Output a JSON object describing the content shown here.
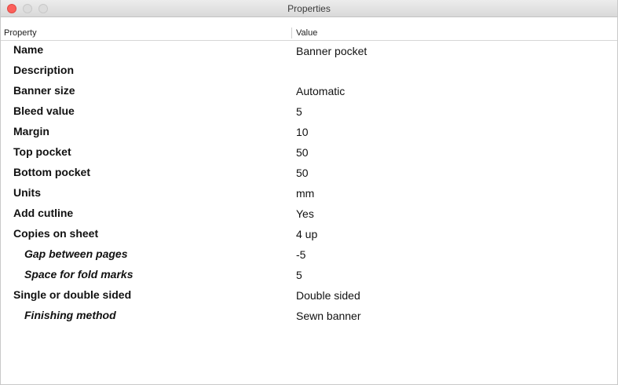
{
  "window": {
    "title": "Properties"
  },
  "table": {
    "headers": {
      "property": "Property",
      "value": "Value"
    },
    "rows": [
      {
        "name": "Name",
        "value": "Banner pocket"
      },
      {
        "name": "Description",
        "value": ""
      },
      {
        "name": "Banner size",
        "value": "Automatic"
      },
      {
        "name": "Bleed value",
        "value": "5"
      },
      {
        "name": "Margin",
        "value": "10"
      },
      {
        "name": "Top pocket",
        "value": "50"
      },
      {
        "name": "Bottom pocket",
        "value": "50"
      },
      {
        "name": "Units",
        "value": "mm"
      },
      {
        "name": "Add cutline",
        "value": "Yes"
      },
      {
        "name": "Copies on sheet",
        "value": "4 up"
      },
      {
        "name": "Gap between pages",
        "value": "-5"
      },
      {
        "name": "Space for fold marks",
        "value": "5"
      },
      {
        "name": "Single or double sided",
        "value": "Double sided"
      },
      {
        "name": "Finishing method",
        "value": "Sewn banner"
      }
    ]
  }
}
